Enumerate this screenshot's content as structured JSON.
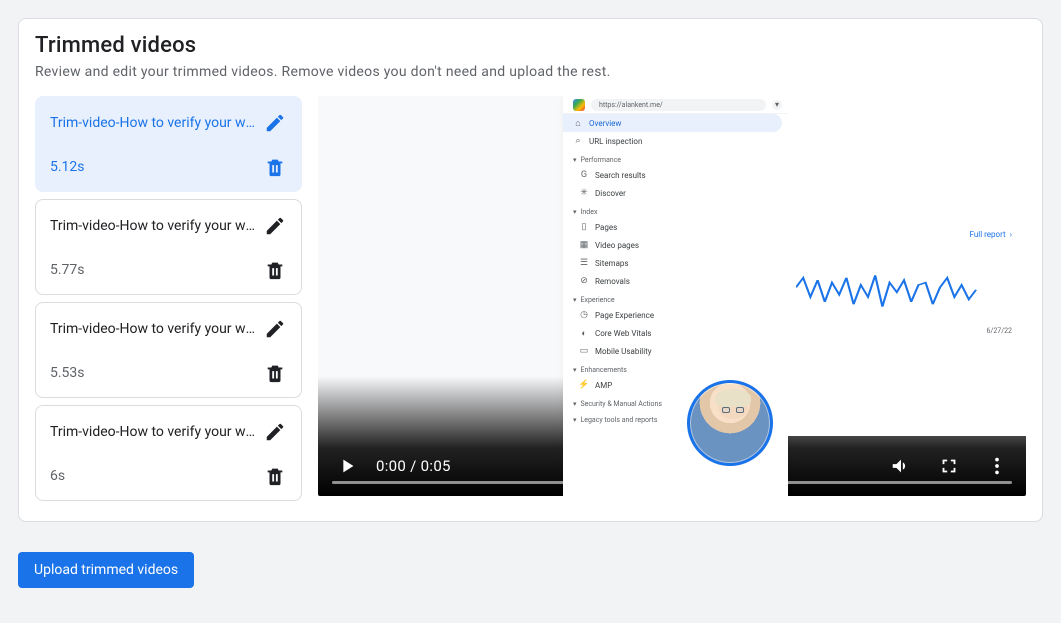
{
  "panel": {
    "title": "Trimmed videos",
    "subtitle": "Review and edit your trimmed videos. Remove videos you don't need and upload the rest."
  },
  "clips": [
    {
      "name": "Trim-video-How to verify your we…",
      "duration": "5.12s",
      "selected": true
    },
    {
      "name": "Trim-video-How to verify your we…",
      "duration": "5.77s",
      "selected": false
    },
    {
      "name": "Trim-video-How to verify your we…",
      "duration": "5.53s",
      "selected": false
    },
    {
      "name": "Trim-video-How to verify your we…",
      "duration": "6s",
      "selected": false
    }
  ],
  "player": {
    "time_label": "0:00 / 0:05"
  },
  "gsc": {
    "url": "https://alankent.me/",
    "items_main": [
      {
        "icon": "⌂",
        "label": "Overview",
        "hl": true
      },
      {
        "icon": "⌕",
        "label": "URL inspection",
        "hl": false
      }
    ],
    "section_perf": "Performance",
    "items_perf": [
      {
        "icon": "G",
        "label": "Search results"
      },
      {
        "icon": "✳",
        "label": "Discover"
      }
    ],
    "section_index": "Index",
    "items_index": [
      {
        "icon": "▯",
        "label": "Pages"
      },
      {
        "icon": "▦",
        "label": "Video pages"
      },
      {
        "icon": "☰",
        "label": "Sitemaps"
      },
      {
        "icon": "⊘",
        "label": "Removals"
      }
    ],
    "section_exp": "Experience",
    "items_exp": [
      {
        "icon": "◷",
        "label": "Page Experience"
      },
      {
        "icon": "◐",
        "label": "Core Web Vitals"
      },
      {
        "icon": "▭",
        "label": "Mobile Usability"
      }
    ],
    "section_enh": "Enhancements",
    "items_enh": [
      {
        "icon": "⚡",
        "label": "AMP"
      }
    ],
    "section_sec": "Security & Manual Actions",
    "section_leg": "Legacy tools and reports",
    "full_report": "Full report",
    "date_tick": "6/27/22"
  },
  "actions": {
    "upload_label": "Upload trimmed videos"
  }
}
